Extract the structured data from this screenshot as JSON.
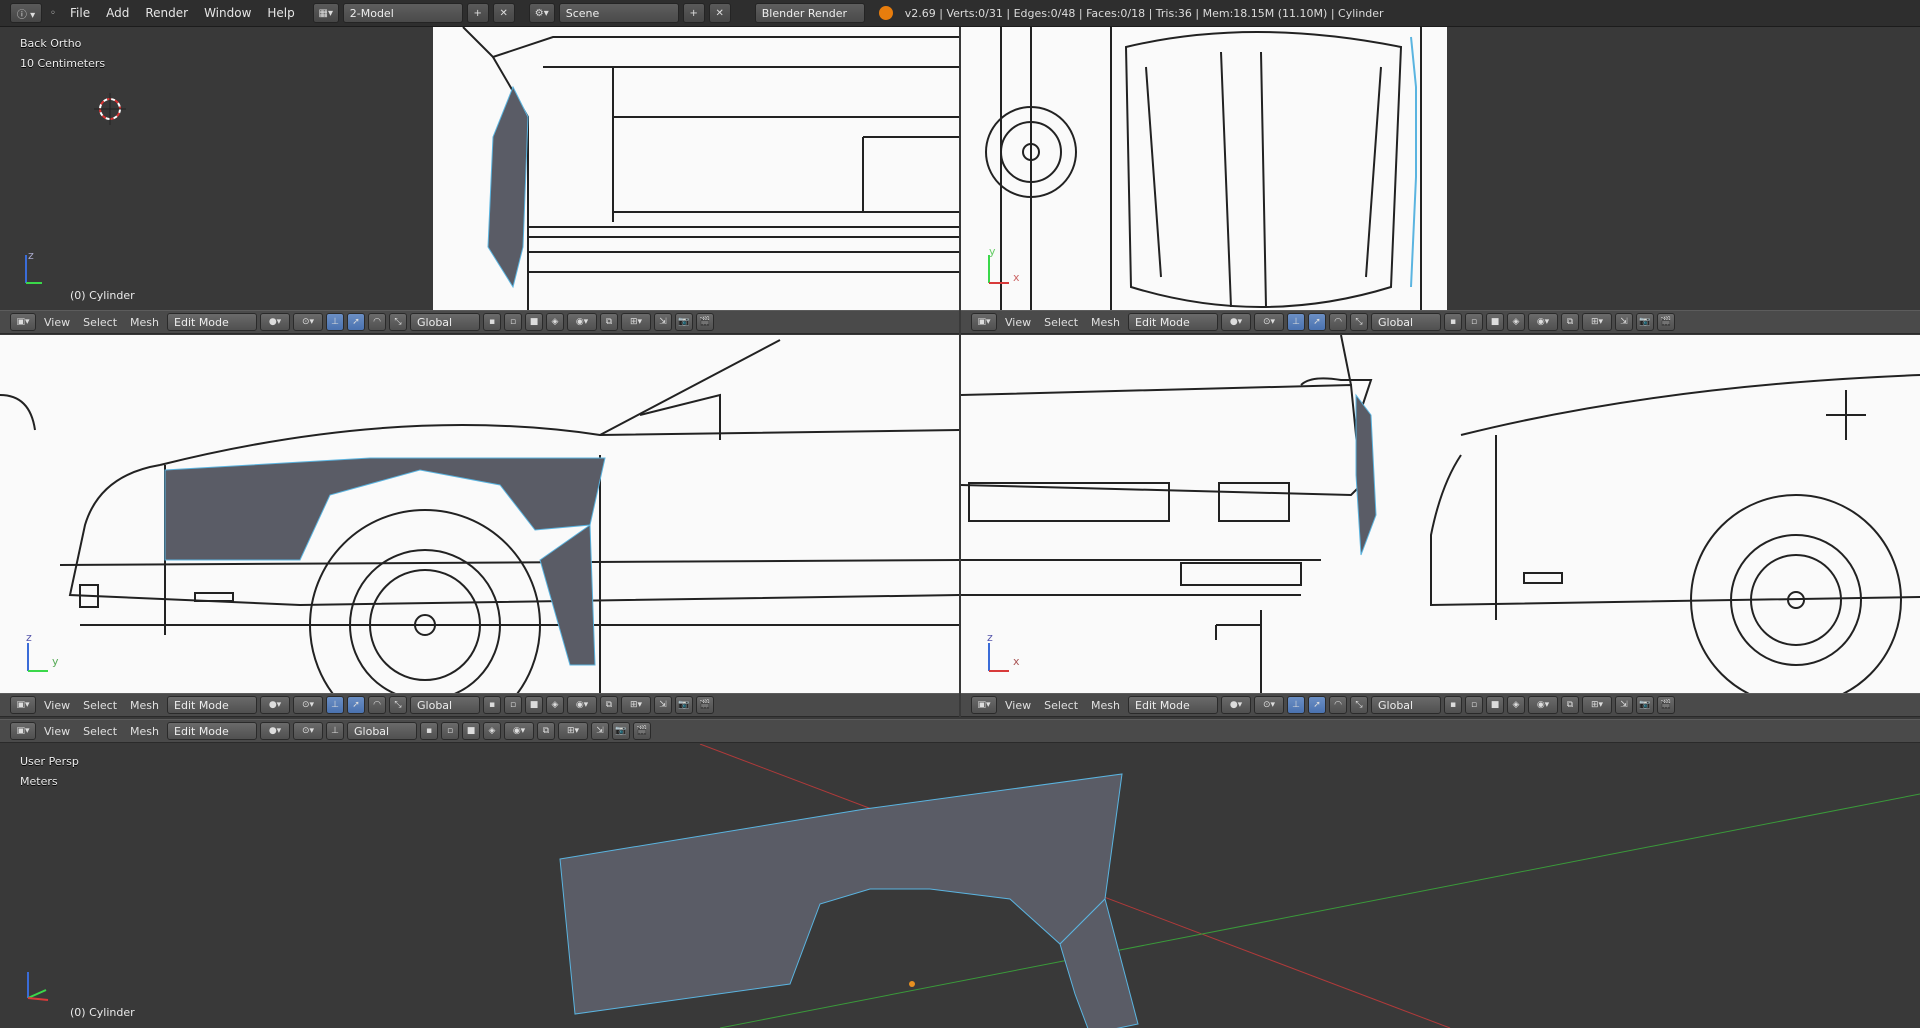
{
  "topbar": {
    "menus": [
      "File",
      "Add",
      "Render",
      "Window",
      "Help"
    ],
    "screen_layout": "2-Model",
    "scene": "Scene",
    "render_engine": "Blender Render",
    "stats": "v2.69 | Verts:0/31 | Edges:0/48 | Faces:0/18 | Tris:36 | Mem:18.15M (11.10M) | Cylinder"
  },
  "viewports": {
    "top_left": {
      "view": "Back Ortho",
      "scale": "10 Centimeters",
      "object": "(0) Cylinder"
    },
    "bottom": {
      "view": "User Persp",
      "scale": "Meters",
      "object": "(0) Cylinder"
    }
  },
  "header": {
    "menus": [
      "View",
      "Select",
      "Mesh"
    ],
    "mode": "Edit Mode",
    "orientation": "Global"
  },
  "axes": {
    "z": "z",
    "y": "y",
    "x": "x"
  },
  "colors": {
    "mesh_edge": "#5ab4e0",
    "mesh_face": "#5a5c66",
    "vertex": "#e04040",
    "grid_x": "#b03a3a",
    "grid_y": "#3a9a3a",
    "active_button": "#4a72b0",
    "logo": "#e87d0d"
  }
}
